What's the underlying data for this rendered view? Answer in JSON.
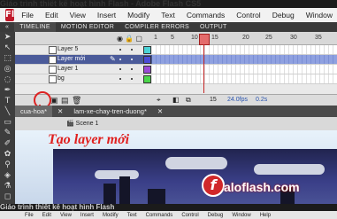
{
  "banner_top": "Giáo trình thiết kế hoạt hình Flash - Adobe Flash CS5",
  "menubar": {
    "logo": "Fl",
    "items": [
      "File",
      "Edit",
      "View",
      "Insert",
      "Modify",
      "Text",
      "Commands",
      "Control",
      "Debug",
      "Window"
    ]
  },
  "panel_tabs": [
    "TIMELINE",
    "MOTION EDITOR",
    "COMPILER ERRORS",
    "OUTPUT"
  ],
  "ruler_numbers": [
    "5",
    "10",
    "15",
    "20",
    "25",
    "30",
    "35"
  ],
  "layers": [
    {
      "name": "Layer 5",
      "color": "#4bd2d6",
      "selected": false
    },
    {
      "name": "Layer mới",
      "color": "#4b4bd6",
      "selected": true
    },
    {
      "name": "Layer 1",
      "color": "#9a4bd6",
      "selected": false
    },
    {
      "name": "bg",
      "color": "#4bd64b",
      "selected": false
    }
  ],
  "timeline_footer": {
    "frame": "15",
    "fps": "24.0fps",
    "time": "0.2s"
  },
  "doc_tabs": [
    "cua-hoa*",
    "lam-xe-chay-tren-duong*"
  ],
  "scene_label": "Scene 1",
  "callout": "Tạo layer mới",
  "watermark": "aloflash.com",
  "banner_bottom": "Giáo trình thiết kế hoạt hình Flash",
  "bottom_menu": [
    "File",
    "Edit",
    "View",
    "Insert",
    "Modify",
    "Text",
    "Commands",
    "Control",
    "Debug",
    "Window",
    "Help"
  ],
  "accent_color": "#e0201f"
}
